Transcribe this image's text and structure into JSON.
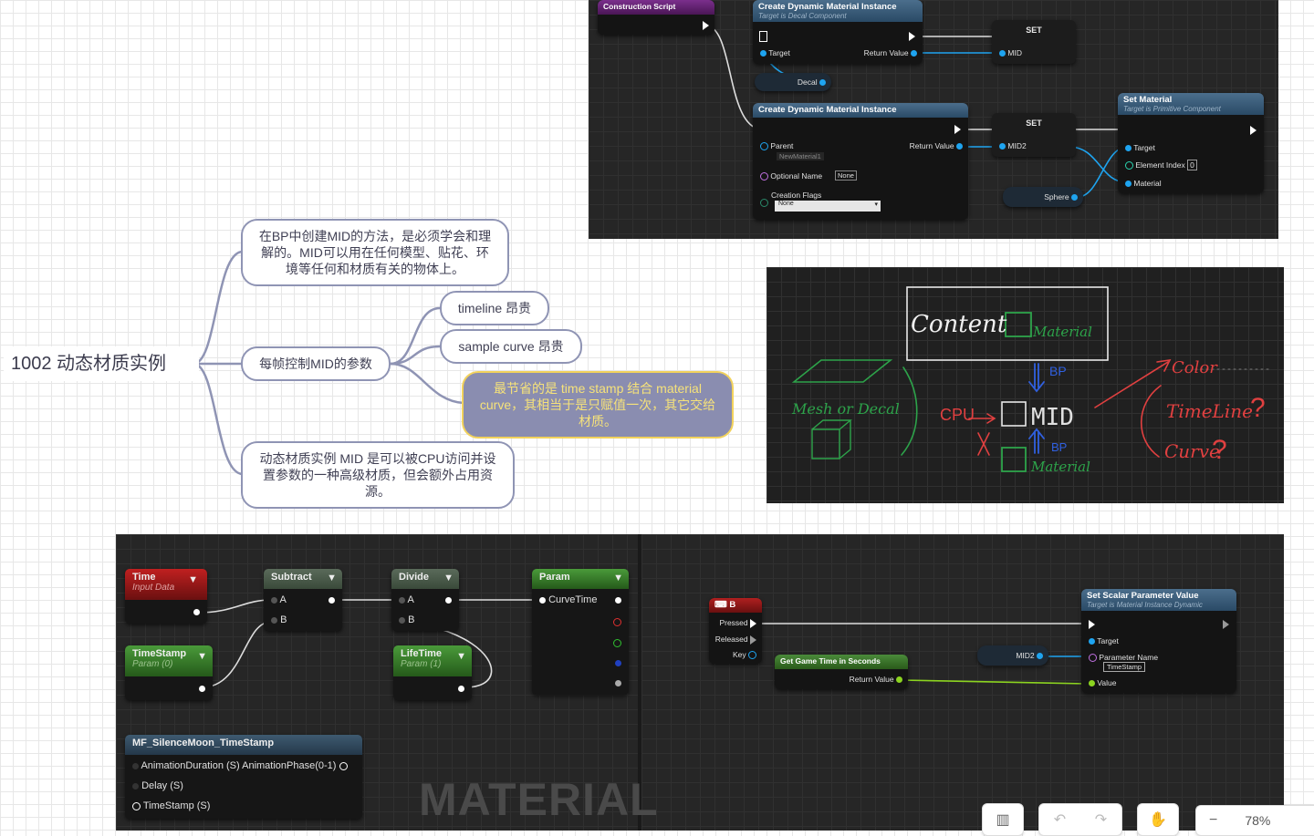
{
  "mindmap": {
    "root": "1002 动态材质实例",
    "node1": "在BP中创建MID的方法，是必须学会和理解的。MID可以用在任何模型、贴花、环境等任何和材质有关的物体上。",
    "node2": "每帧控制MID的参数",
    "node2_children": [
      "timeline 昂贵",
      "sample curve 昂贵",
      "最节省的是 time stamp 结合 material curve，其相当于是只赋值一次，其它交给材质。"
    ],
    "node3": "动态材质实例 MID 是可以被CPU访问并设置参数的一种高级材质，但会额外占用资源。"
  },
  "bp_top": {
    "construction": "Construction Script",
    "cdmi1": {
      "title": "Create Dynamic Material Instance",
      "subtitle": "Target is Decal Component",
      "target": "Target",
      "ret": "Return Value"
    },
    "set1": {
      "title": "SET",
      "pin": "MID"
    },
    "decal": "Decal",
    "cdmi2": {
      "title": "Create Dynamic Material Instance",
      "parent": "Parent",
      "parent_val": "NewMaterial1",
      "ret": "Return Value",
      "optname": "Optional Name",
      "optname_val": "None",
      "flags": "Creation Flags",
      "flags_val": "None"
    },
    "set2": {
      "title": "SET",
      "pin": "MID2"
    },
    "setmat": {
      "title": "Set Material",
      "subtitle": "Target is Primitive Component",
      "target": "Target",
      "index": "Element Index",
      "index_val": "0",
      "material": "Material"
    },
    "sphere": "Sphere"
  },
  "diagram": {
    "content": "Content",
    "material_top": "Material",
    "bp_top": "BP",
    "mesh": "Mesh or Decal",
    "cpu": "CPU",
    "mid": "MID",
    "bp_bottom": "BP",
    "material_bottom": "Material",
    "color": "Color",
    "timeline": "TimeLine",
    "curve": "Curve"
  },
  "bp_bottom": {
    "time": {
      "title": "Time",
      "sub": "Input Data"
    },
    "timestamp": {
      "title": "TimeStamp",
      "sub": "Param (0)"
    },
    "subtract": {
      "title": "Subtract",
      "a": "A",
      "b": "B"
    },
    "divide": {
      "title": "Divide",
      "a": "A",
      "b": "B"
    },
    "lifetime": {
      "title": "LifeTime",
      "sub": "Param (1)"
    },
    "param": {
      "title": "Param",
      "pin": "CurveTime"
    },
    "mf": {
      "title": "MF_SilenceMoon_TimeStamp",
      "p1": "AnimationDuration (S) AnimationPhase(0-1)",
      "p2": "Delay (S)",
      "p3": "TimeStamp (S)"
    },
    "watermark": "MATERIAL",
    "key": {
      "title": "B",
      "pressed": "Pressed",
      "released": "Released",
      "key": "Key"
    },
    "gettime": {
      "title": "Get Game Time in Seconds",
      "ret": "Return Value"
    },
    "mid2": "MID2",
    "setscalar": {
      "title": "Set Scalar Parameter Value",
      "subtitle": "Target is Material Instance Dynamic",
      "target": "Target",
      "pname": "Parameter Name",
      "pname_val": "TimeStamp",
      "value": "Value"
    }
  },
  "toolbar": {
    "zoom": "78%"
  }
}
